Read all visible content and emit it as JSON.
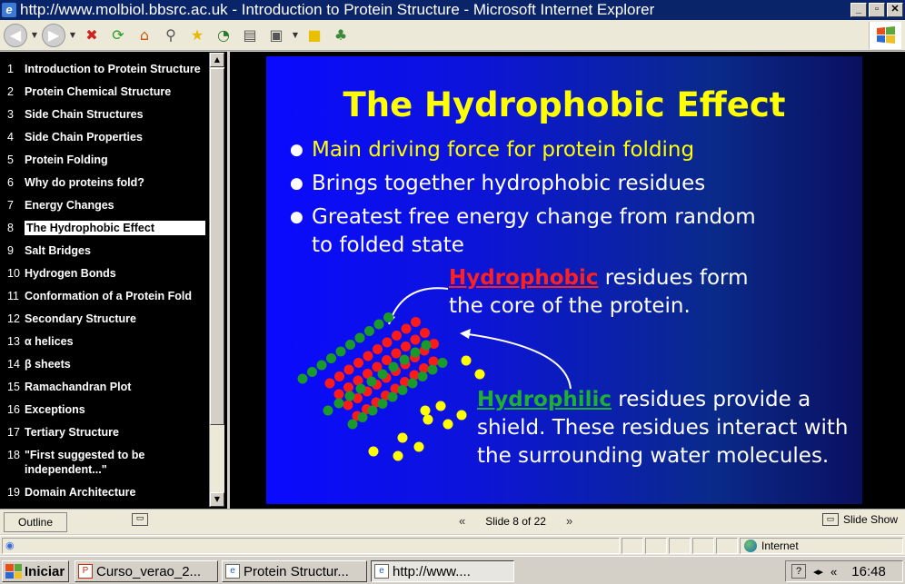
{
  "window": {
    "title": "http://www.molbiol.bbsrc.ac.uk - Introduction to Protein Structure - Microsoft Internet Explorer",
    "buttons": [
      "_",
      "▫",
      "✕"
    ]
  },
  "toolbar": {
    "icons": [
      "back-icon",
      "back-dropdown-icon",
      "forward-icon",
      "forward-dropdown-icon",
      "stop-icon",
      "refresh-icon",
      "home-icon",
      "search-icon",
      "favorites-icon",
      "history-icon",
      "print-icon",
      "edit-icon",
      "edit-dropdown-icon",
      "notepad-icon",
      "messenger-icon"
    ]
  },
  "outline": {
    "items": [
      {
        "num": "1",
        "title": "Introduction to Protein Structure"
      },
      {
        "num": "2",
        "title": "Protein Chemical Structure"
      },
      {
        "num": "3",
        "title": "Side Chain Structures"
      },
      {
        "num": "4",
        "title": "Side Chain Properties"
      },
      {
        "num": "5",
        "title": "Protein Folding"
      },
      {
        "num": "6",
        "title": "Why do proteins fold?"
      },
      {
        "num": "7",
        "title": "Energy Changes"
      },
      {
        "num": "8",
        "title": "The Hydrophobic Effect"
      },
      {
        "num": "9",
        "title": "Salt Bridges"
      },
      {
        "num": "10",
        "title": "Hydrogen Bonds"
      },
      {
        "num": "11",
        "title": "Conformation of a Protein Fold"
      },
      {
        "num": "12",
        "title": "Secondary Structure"
      },
      {
        "num": "13",
        "title": "α helices"
      },
      {
        "num": "14",
        "title": "β sheets"
      },
      {
        "num": "15",
        "title": "Ramachandran Plot"
      },
      {
        "num": "16",
        "title": "Exceptions"
      },
      {
        "num": "17",
        "title": "Tertiary Structure"
      },
      {
        "num": "18",
        "title": "\"First suggested to be independent...\""
      },
      {
        "num": "19",
        "title": "Domain Architecture"
      }
    ],
    "selected_index": 7,
    "tab_label": "Outline"
  },
  "slide": {
    "title": "The Hydrophobic Effect",
    "bullets": [
      "Main driving force for protein folding",
      "Brings together hydrophobic residues",
      "Greatest free energy change from random to folded state"
    ],
    "hydrophobic_word": "Hydrophobic",
    "hydrophobic_rest": " residues form the core of the protein.",
    "hydrophilic_word": "Hydrophilic",
    "hydrophilic_rest": " residues provide a shield. These residues interact with the surrounding water molecules."
  },
  "slidenav": {
    "counter": "Slide 8 of 22",
    "slideshow_label": "Slide Show"
  },
  "status": {
    "zone": "Internet"
  },
  "taskbar": {
    "start": "Iniciar",
    "tasks": [
      "Curso_verao_2...",
      "Protein Structur...",
      "http://www...."
    ],
    "clock": "16:48"
  },
  "colors": {
    "slide_title": "#ffff00",
    "hydrophobic": "#ff2020",
    "hydrophilic": "#20b030",
    "slide_bg": "#0c14d9"
  }
}
